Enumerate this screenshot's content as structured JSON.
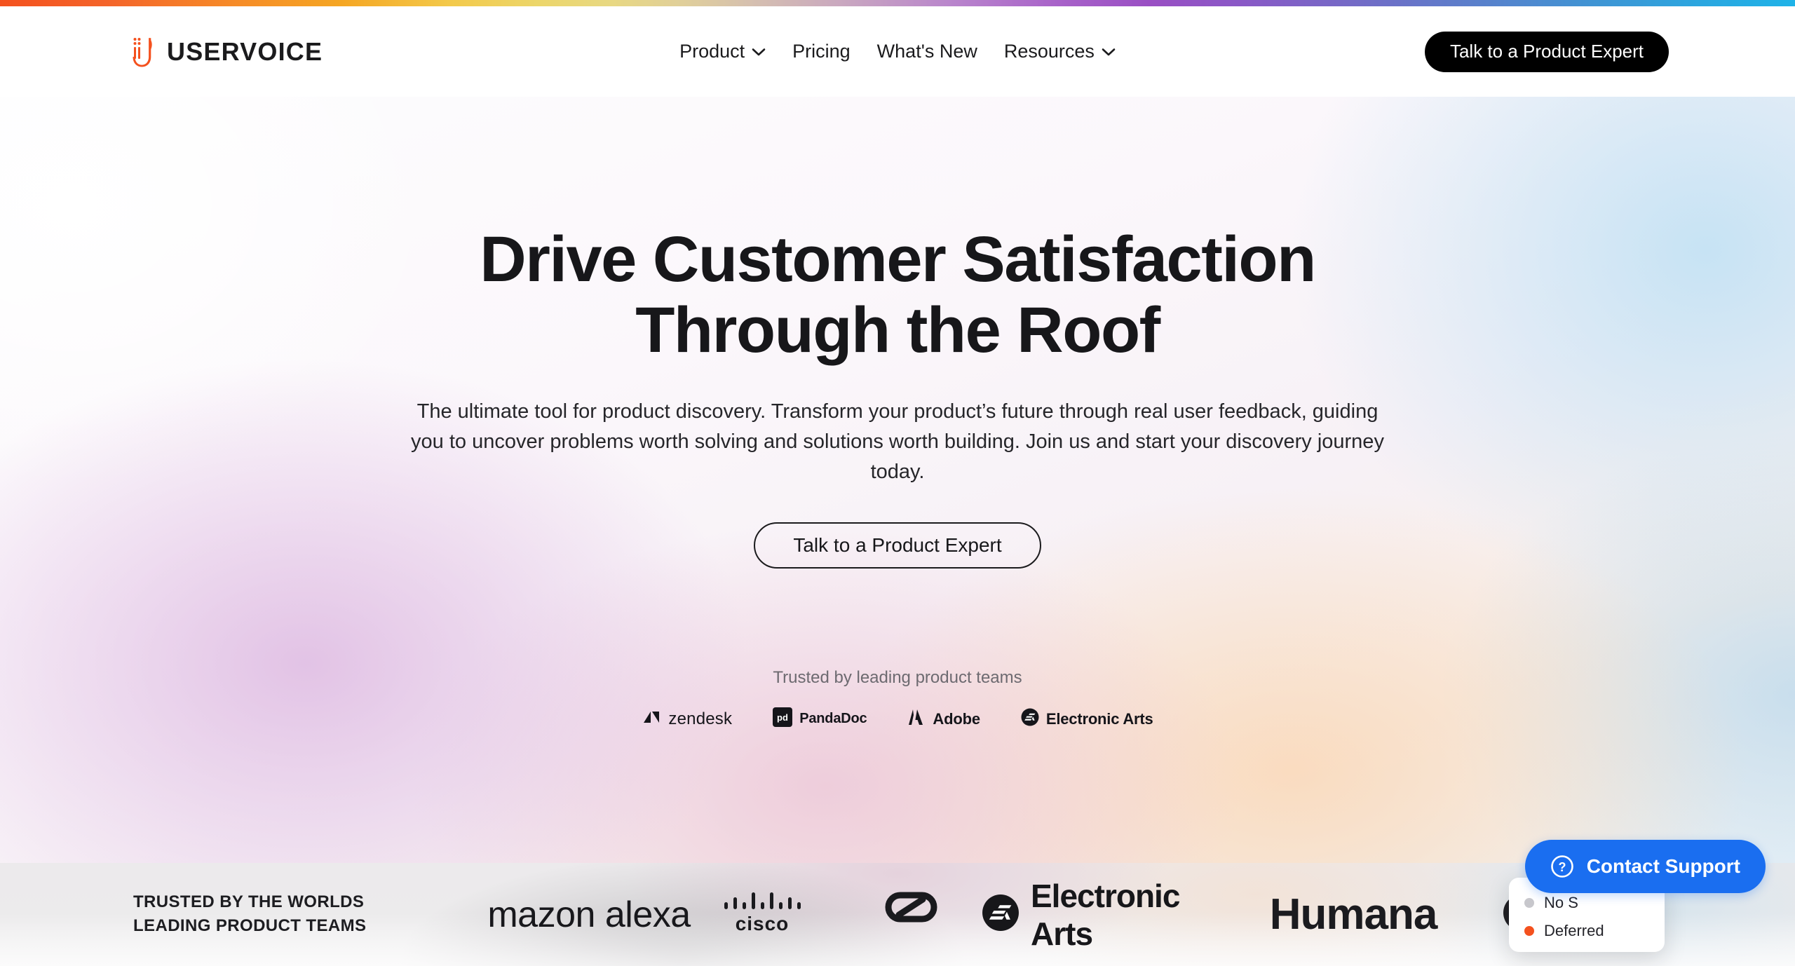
{
  "brand": {
    "name": "USERVOICE",
    "logo_icon": "uservoice-mark-icon",
    "accent_color": "#f4511e"
  },
  "top_bar": {
    "icon": "rainbow-gradient-bar",
    "gradient_stops": [
      "#f4511e",
      "#f5a623",
      "#ecd66a",
      "#b985cc",
      "#9a4fc4",
      "#5b7fcb",
      "#1fb3e8"
    ]
  },
  "nav": {
    "items": [
      {
        "label": "Product",
        "has_dropdown": true,
        "icon": "chevron-down-icon"
      },
      {
        "label": "Pricing",
        "has_dropdown": false,
        "icon": ""
      },
      {
        "label": "What's New",
        "has_dropdown": false,
        "icon": ""
      },
      {
        "label": "Resources",
        "has_dropdown": true,
        "icon": "chevron-down-icon"
      }
    ],
    "cta_label": "Talk to a Product Expert"
  },
  "hero": {
    "title_line1": "Drive Customer Satisfaction",
    "title_line2": "Through the Roof",
    "subtitle": "The ultimate tool for product discovery. Transform your product’s future through real user feedback, guiding you to uncover problems worth solving and solutions worth building. Join us and start your discovery journey today.",
    "cta_label": "Talk to a Product Expert",
    "background_colors": [
      "#fdfdfe",
      "#debae2",
      "#fad6b4",
      "#c4e2f4"
    ]
  },
  "trusted": {
    "label": "Trusted by leading product teams",
    "logos": [
      {
        "name": "zendesk",
        "label": "zendesk",
        "icon": "zendesk-logo-icon"
      },
      {
        "name": "pandadoc",
        "label": "PandaDoc",
        "icon": "pandadoc-logo-icon"
      },
      {
        "name": "adobe",
        "label": "Adobe",
        "icon": "adobe-logo-icon"
      },
      {
        "name": "electronic-arts",
        "label": "Electronic Arts",
        "icon": "ea-logo-icon"
      }
    ]
  },
  "bottom_strip": {
    "headline_line1": "TRUSTED BY THE WORLDS",
    "headline_line2": "LEADING PRODUCT TEAMS",
    "logos": [
      {
        "name": "amazon-alexa",
        "label": "mazon alexa",
        "icon": "amazon-alexa-logo-icon"
      },
      {
        "name": "cisco",
        "label": "CISCO",
        "icon": "cisco-logo-icon"
      },
      {
        "name": "adobe-creative-cloud",
        "label": "",
        "icon": "adobe-creative-cloud-logo-icon"
      },
      {
        "name": "electronic-arts",
        "label": "Electronic Arts",
        "icon": "ea-logo-icon"
      },
      {
        "name": "humana",
        "label": "Humana",
        "icon": "humana-logo-icon"
      },
      {
        "name": "pie-mark",
        "label": "",
        "icon": "pie-mark-logo-icon"
      }
    ]
  },
  "support_widget": {
    "label": "Contact Support",
    "icon": "question-circle-icon",
    "color": "#1a6ef0"
  },
  "status_popover": {
    "rows": [
      {
        "label": "No S",
        "dot_color": "#c7c7cc"
      },
      {
        "label": "Deferred",
        "dot_color": "#f4511e"
      }
    ]
  }
}
